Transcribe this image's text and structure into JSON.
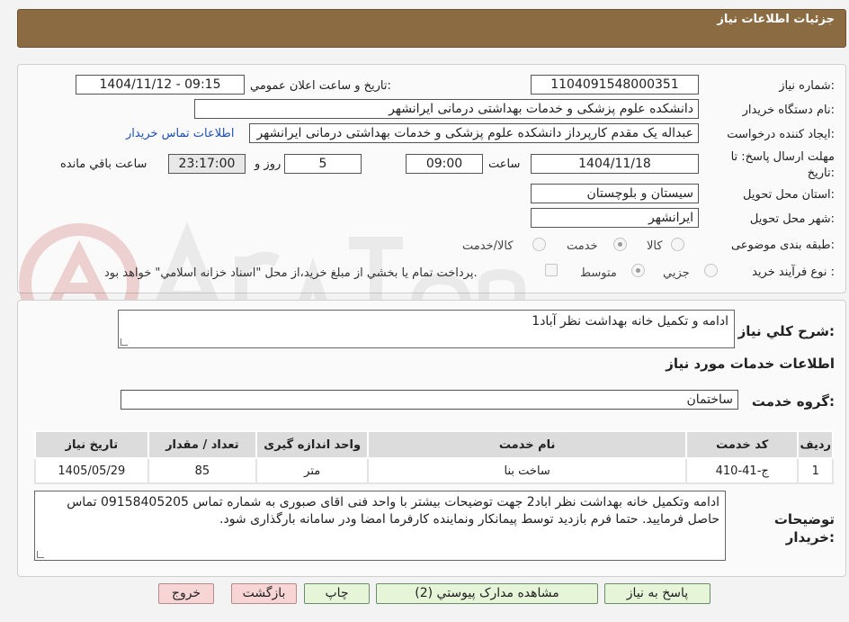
{
  "header": {
    "title": "جزئیات اطلاعات نیاز"
  },
  "fields": {
    "need_number_label": "شماره نیاز:",
    "need_number": "1104091548000351",
    "announce_label": "تاریخ و ساعت اعلان عمومي:",
    "announce_value": "1404/11/12 - 09:15",
    "buyer_org_label": "نام دستگاه خريدار:",
    "buyer_org": "دانشکده علوم پزشکی و خدمات بهداشتی درمانی ایرانشهر",
    "requester_label": "ايجاد کننده درخواست:",
    "requester": "عبداله یک مقدم کارپرداز دانشکده علوم پزشکی و خدمات بهداشتی درمانی ایرانشهر",
    "contact_link": "اطلاعات تماس خريدار",
    "deadline_label": "مهلت ارسال پاسخ: تا تاريخ:",
    "deadline_date": "1404/11/18",
    "time_label": "ساعت",
    "deadline_time": "09:00",
    "days_value": "5",
    "days_label": "روز و",
    "remaining_time": "23:17:00",
    "remaining_label": "ساعت باقي مانده",
    "province_label": "استان محل تحويل:",
    "province": "سیستان و بلوچستان",
    "city_label": "شهر محل تحويل:",
    "city": "ایرانشهر",
    "category_label": "طبقه بندی موضوعی:",
    "category_options": [
      "کالا",
      "خدمت",
      "کالا/خدمت"
    ],
    "category_selected": "خدمت",
    "process_label": "نوع فرآيند خريد :",
    "process_options": [
      "جزيي",
      "متوسط"
    ],
    "process_selected": "متوسط",
    "payment_note": "پرداخت تمام يا بخشي از مبلغ خريد،از محل \"اسناد خزانه اسلامي\" خواهد بود."
  },
  "description": {
    "label": "شرح کلي نياز:",
    "value": "ادامه و تکمیل خانه بهداشت نظر آباد1"
  },
  "services": {
    "section_title": "اطلاعات خدمات مورد نياز",
    "group_label": "گروه خدمت:",
    "group_value": "ساختمان",
    "columns": [
      "رديف",
      "کد خدمت",
      "نام خدمت",
      "واحد اندازه گيری",
      "تعداد / مقدار",
      "تاريخ نياز"
    ],
    "rows": [
      [
        "1",
        "ج-41-410",
        "ساخت بنا",
        "متر",
        "85",
        "1405/05/29"
      ]
    ]
  },
  "buyer_notes": {
    "label": "توضيحات خريدار:",
    "value": "ادامه وتکمیل  خانه بهداشت نظر اباد2  جهت  توضیحات بیشتر با واحد فنی اقای صبوری به شماره تماس 09158405205 تماس حاصل فرمایید. حتما فرم بازدید توسط پیمانکار ونماینده کارفرما امضا ودر سامانه بارگذاری شود."
  },
  "buttons": {
    "reply": "پاسخ به نياز",
    "attachments": "مشاهده مدارک پيوستي (2)",
    "print": "چاپ",
    "back": "بازگشت",
    "exit": "خروج"
  },
  "colors": {
    "header": "#8b6b42",
    "button_green": "#e6f5d8",
    "button_pink": "#f8d5d5",
    "link": "#1f4fb8"
  }
}
